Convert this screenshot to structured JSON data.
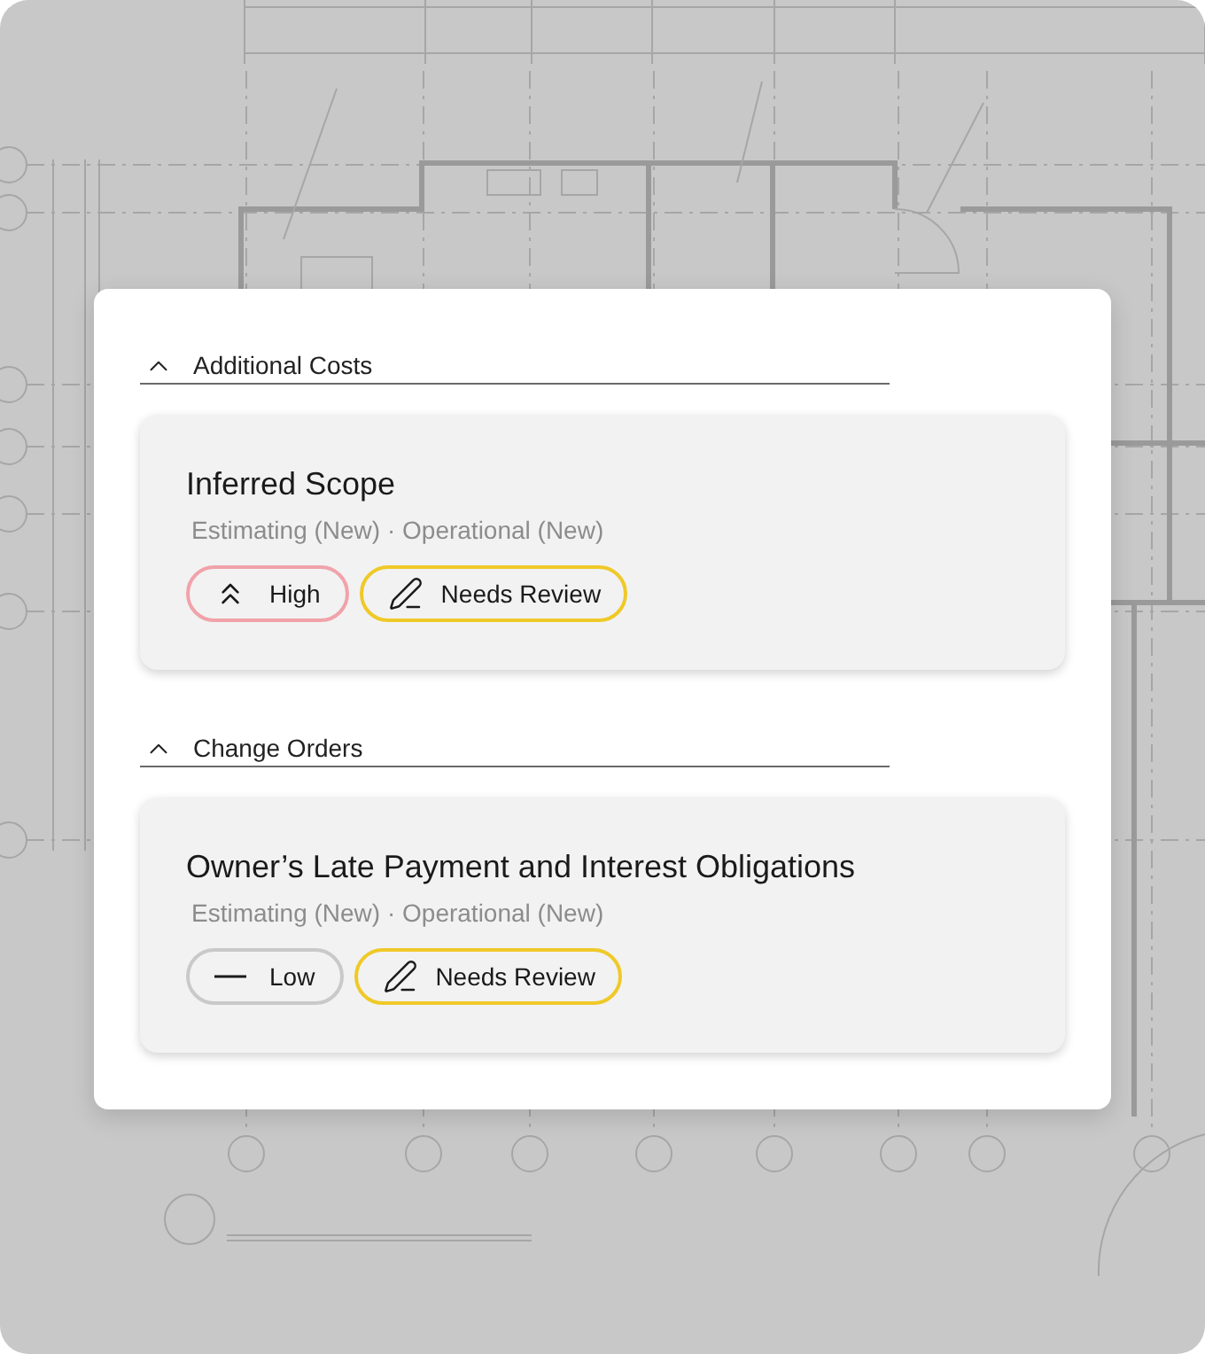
{
  "sections": [
    {
      "title": "Additional Costs",
      "expanded": true,
      "items": [
        {
          "title": "Inferred Scope",
          "subtitle": "Estimating (New) · Operational (New)",
          "priority": {
            "kind": "high",
            "label": "High"
          },
          "status": {
            "kind": "review",
            "label": "Needs Review"
          }
        }
      ]
    },
    {
      "title": "Change Orders",
      "expanded": true,
      "items": [
        {
          "title": "Owner’s Late Payment and Interest Obligations",
          "subtitle": "Estimating (New) · Operational (New)",
          "priority": {
            "kind": "low",
            "label": "Low"
          },
          "status": {
            "kind": "review",
            "label": "Needs Review"
          }
        }
      ]
    }
  ]
}
